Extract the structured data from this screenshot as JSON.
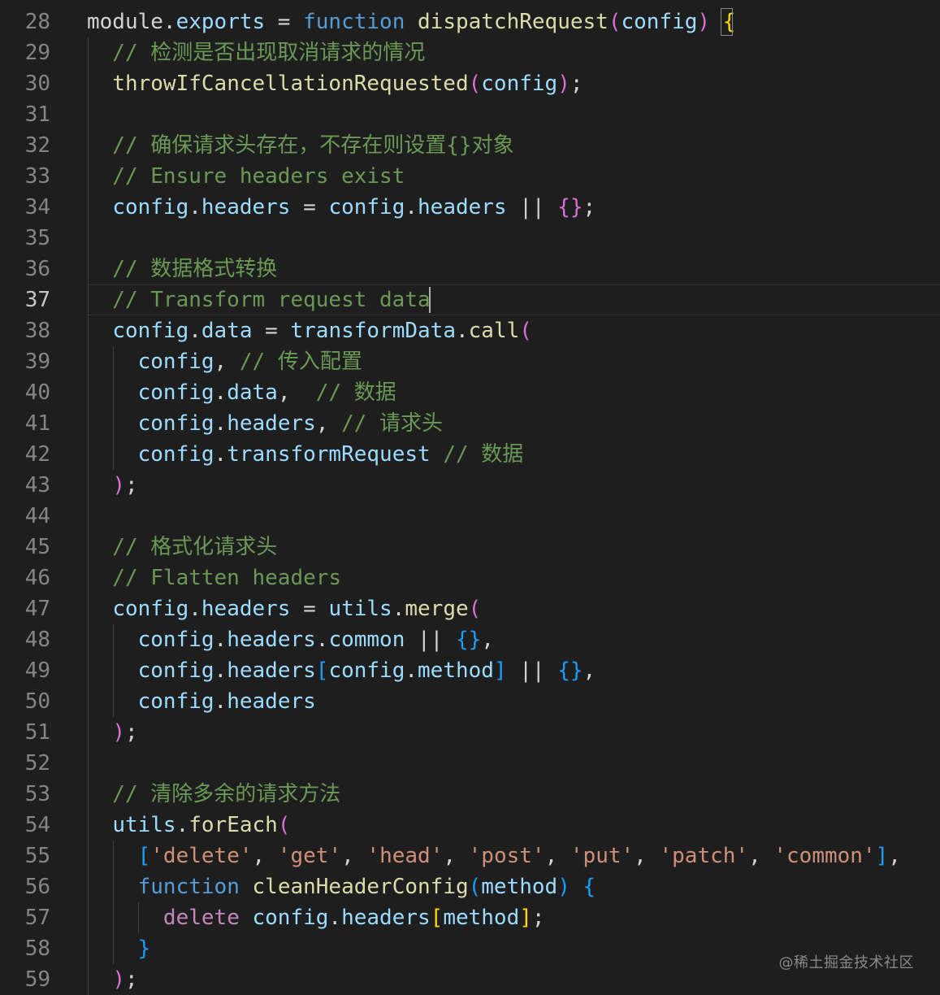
{
  "editor": {
    "colors": {
      "background": "#1e1e1e",
      "line_number": "#858585",
      "line_number_active": "#c6c6c6",
      "keyword": "#569cd6",
      "control_keyword": "#c586c0",
      "function": "#dcdcaa",
      "variable": "#9cdcfe",
      "comment": "#6a9955",
      "string": "#ce9178",
      "bracket_1": "#ffd700",
      "bracket_2": "#da70d6",
      "bracket_3": "#179fff"
    },
    "current_line": 37,
    "lines": [
      {
        "num": "28",
        "tokens": [
          [
            "module",
            "plain"
          ],
          [
            ".",
            "op"
          ],
          [
            "exports",
            "var"
          ],
          [
            " = ",
            "op"
          ],
          [
            "function",
            "kw"
          ],
          [
            " ",
            "op"
          ],
          [
            "dispatchRequest",
            "fn"
          ],
          [
            "(",
            "b2"
          ],
          [
            "config",
            "var"
          ],
          [
            ")",
            "b2"
          ],
          [
            " ",
            "op"
          ],
          [
            "{",
            "b1"
          ]
        ]
      },
      {
        "num": "29",
        "tokens": [
          [
            "  // 检测是否出现取消请求的情况",
            "cmt"
          ]
        ]
      },
      {
        "num": "30",
        "tokens": [
          [
            "  ",
            "op"
          ],
          [
            "throwIfCancellationRequested",
            "fn"
          ],
          [
            "(",
            "b2"
          ],
          [
            "config",
            "var"
          ],
          [
            ")",
            "b2"
          ],
          [
            ";",
            "op"
          ]
        ]
      },
      {
        "num": "31",
        "tokens": []
      },
      {
        "num": "32",
        "tokens": [
          [
            "  // 确保请求头存在，不存在则设置{}对象",
            "cmt"
          ]
        ]
      },
      {
        "num": "33",
        "tokens": [
          [
            "  // Ensure headers exist",
            "cmt"
          ]
        ]
      },
      {
        "num": "34",
        "tokens": [
          [
            "  ",
            "op"
          ],
          [
            "config",
            "var"
          ],
          [
            ".",
            "op"
          ],
          [
            "headers",
            "var"
          ],
          [
            " = ",
            "op"
          ],
          [
            "config",
            "var"
          ],
          [
            ".",
            "op"
          ],
          [
            "headers",
            "var"
          ],
          [
            " || ",
            "op"
          ],
          [
            "{}",
            "b2"
          ],
          [
            ";",
            "op"
          ]
        ]
      },
      {
        "num": "35",
        "tokens": []
      },
      {
        "num": "36",
        "tokens": [
          [
            "  // 数据格式转换",
            "cmt"
          ]
        ]
      },
      {
        "num": "37",
        "tokens": [
          [
            "  // Transform request data",
            "cmt"
          ]
        ]
      },
      {
        "num": "38",
        "tokens": [
          [
            "  ",
            "op"
          ],
          [
            "config",
            "var"
          ],
          [
            ".",
            "op"
          ],
          [
            "data",
            "var"
          ],
          [
            " = ",
            "op"
          ],
          [
            "transformData",
            "var"
          ],
          [
            ".",
            "op"
          ],
          [
            "call",
            "fn"
          ],
          [
            "(",
            "b2"
          ]
        ]
      },
      {
        "num": "39",
        "tokens": [
          [
            "    ",
            "op"
          ],
          [
            "config",
            "var"
          ],
          [
            ", ",
            "op"
          ],
          [
            "// 传入配置",
            "cmt"
          ]
        ]
      },
      {
        "num": "40",
        "tokens": [
          [
            "    ",
            "op"
          ],
          [
            "config",
            "var"
          ],
          [
            ".",
            "op"
          ],
          [
            "data",
            "var"
          ],
          [
            ",  ",
            "op"
          ],
          [
            "// 数据",
            "cmt"
          ]
        ]
      },
      {
        "num": "41",
        "tokens": [
          [
            "    ",
            "op"
          ],
          [
            "config",
            "var"
          ],
          [
            ".",
            "op"
          ],
          [
            "headers",
            "var"
          ],
          [
            ", ",
            "op"
          ],
          [
            "// 请求头",
            "cmt"
          ]
        ]
      },
      {
        "num": "42",
        "tokens": [
          [
            "    ",
            "op"
          ],
          [
            "config",
            "var"
          ],
          [
            ".",
            "op"
          ],
          [
            "transformRequest",
            "var"
          ],
          [
            " ",
            "op"
          ],
          [
            "// 数据",
            "cmt"
          ]
        ]
      },
      {
        "num": "43",
        "tokens": [
          [
            "  ",
            "op"
          ],
          [
            ")",
            "b2"
          ],
          [
            ";",
            "op"
          ]
        ]
      },
      {
        "num": "44",
        "tokens": []
      },
      {
        "num": "45",
        "tokens": [
          [
            "  // 格式化请求头",
            "cmt"
          ]
        ]
      },
      {
        "num": "46",
        "tokens": [
          [
            "  // Flatten headers",
            "cmt"
          ]
        ]
      },
      {
        "num": "47",
        "tokens": [
          [
            "  ",
            "op"
          ],
          [
            "config",
            "var"
          ],
          [
            ".",
            "op"
          ],
          [
            "headers",
            "var"
          ],
          [
            " = ",
            "op"
          ],
          [
            "utils",
            "var"
          ],
          [
            ".",
            "op"
          ],
          [
            "merge",
            "fn"
          ],
          [
            "(",
            "b2"
          ]
        ]
      },
      {
        "num": "48",
        "tokens": [
          [
            "    ",
            "op"
          ],
          [
            "config",
            "var"
          ],
          [
            ".",
            "op"
          ],
          [
            "headers",
            "var"
          ],
          [
            ".",
            "op"
          ],
          [
            "common",
            "var"
          ],
          [
            " || ",
            "op"
          ],
          [
            "{}",
            "b3"
          ],
          [
            ",",
            "op"
          ]
        ]
      },
      {
        "num": "49",
        "tokens": [
          [
            "    ",
            "op"
          ],
          [
            "config",
            "var"
          ],
          [
            ".",
            "op"
          ],
          [
            "headers",
            "var"
          ],
          [
            "[",
            "b3"
          ],
          [
            "config",
            "var"
          ],
          [
            ".",
            "op"
          ],
          [
            "method",
            "var"
          ],
          [
            "]",
            "b3"
          ],
          [
            " || ",
            "op"
          ],
          [
            "{}",
            "b3"
          ],
          [
            ",",
            "op"
          ]
        ]
      },
      {
        "num": "50",
        "tokens": [
          [
            "    ",
            "op"
          ],
          [
            "config",
            "var"
          ],
          [
            ".",
            "op"
          ],
          [
            "headers",
            "var"
          ]
        ]
      },
      {
        "num": "51",
        "tokens": [
          [
            "  ",
            "op"
          ],
          [
            ")",
            "b2"
          ],
          [
            ";",
            "op"
          ]
        ]
      },
      {
        "num": "52",
        "tokens": []
      },
      {
        "num": "53",
        "tokens": [
          [
            "  // 清除多余的请求方法",
            "cmt"
          ]
        ]
      },
      {
        "num": "54",
        "tokens": [
          [
            "  ",
            "op"
          ],
          [
            "utils",
            "var"
          ],
          [
            ".",
            "op"
          ],
          [
            "forEach",
            "fn"
          ],
          [
            "(",
            "b2"
          ]
        ]
      },
      {
        "num": "55",
        "tokens": [
          [
            "    ",
            "op"
          ],
          [
            "[",
            "b3"
          ],
          [
            "'delete'",
            "str"
          ],
          [
            ", ",
            "op"
          ],
          [
            "'get'",
            "str"
          ],
          [
            ", ",
            "op"
          ],
          [
            "'head'",
            "str"
          ],
          [
            ", ",
            "op"
          ],
          [
            "'post'",
            "str"
          ],
          [
            ", ",
            "op"
          ],
          [
            "'put'",
            "str"
          ],
          [
            ", ",
            "op"
          ],
          [
            "'patch'",
            "str"
          ],
          [
            ", ",
            "op"
          ],
          [
            "'common'",
            "str"
          ],
          [
            "]",
            "b3"
          ],
          [
            ",",
            "op"
          ]
        ]
      },
      {
        "num": "56",
        "tokens": [
          [
            "    ",
            "op"
          ],
          [
            "function",
            "kw"
          ],
          [
            " ",
            "op"
          ],
          [
            "cleanHeaderConfig",
            "fn"
          ],
          [
            "(",
            "b3"
          ],
          [
            "method",
            "var"
          ],
          [
            ")",
            "b3"
          ],
          [
            " ",
            "op"
          ],
          [
            "{",
            "b3"
          ]
        ]
      },
      {
        "num": "57",
        "tokens": [
          [
            "      ",
            "op"
          ],
          [
            "delete",
            "ctl"
          ],
          [
            " ",
            "op"
          ],
          [
            "config",
            "var"
          ],
          [
            ".",
            "op"
          ],
          [
            "headers",
            "var"
          ],
          [
            "[",
            "b1"
          ],
          [
            "method",
            "var"
          ],
          [
            "]",
            "b1"
          ],
          [
            ";",
            "op"
          ]
        ]
      },
      {
        "num": "58",
        "tokens": [
          [
            "    ",
            "op"
          ],
          [
            "}",
            "b3"
          ]
        ]
      },
      {
        "num": "59",
        "tokens": [
          [
            "  ",
            "op"
          ],
          [
            ")",
            "b2"
          ],
          [
            ";",
            "op"
          ]
        ]
      }
    ]
  },
  "watermark": "@稀土掘金技术社区"
}
